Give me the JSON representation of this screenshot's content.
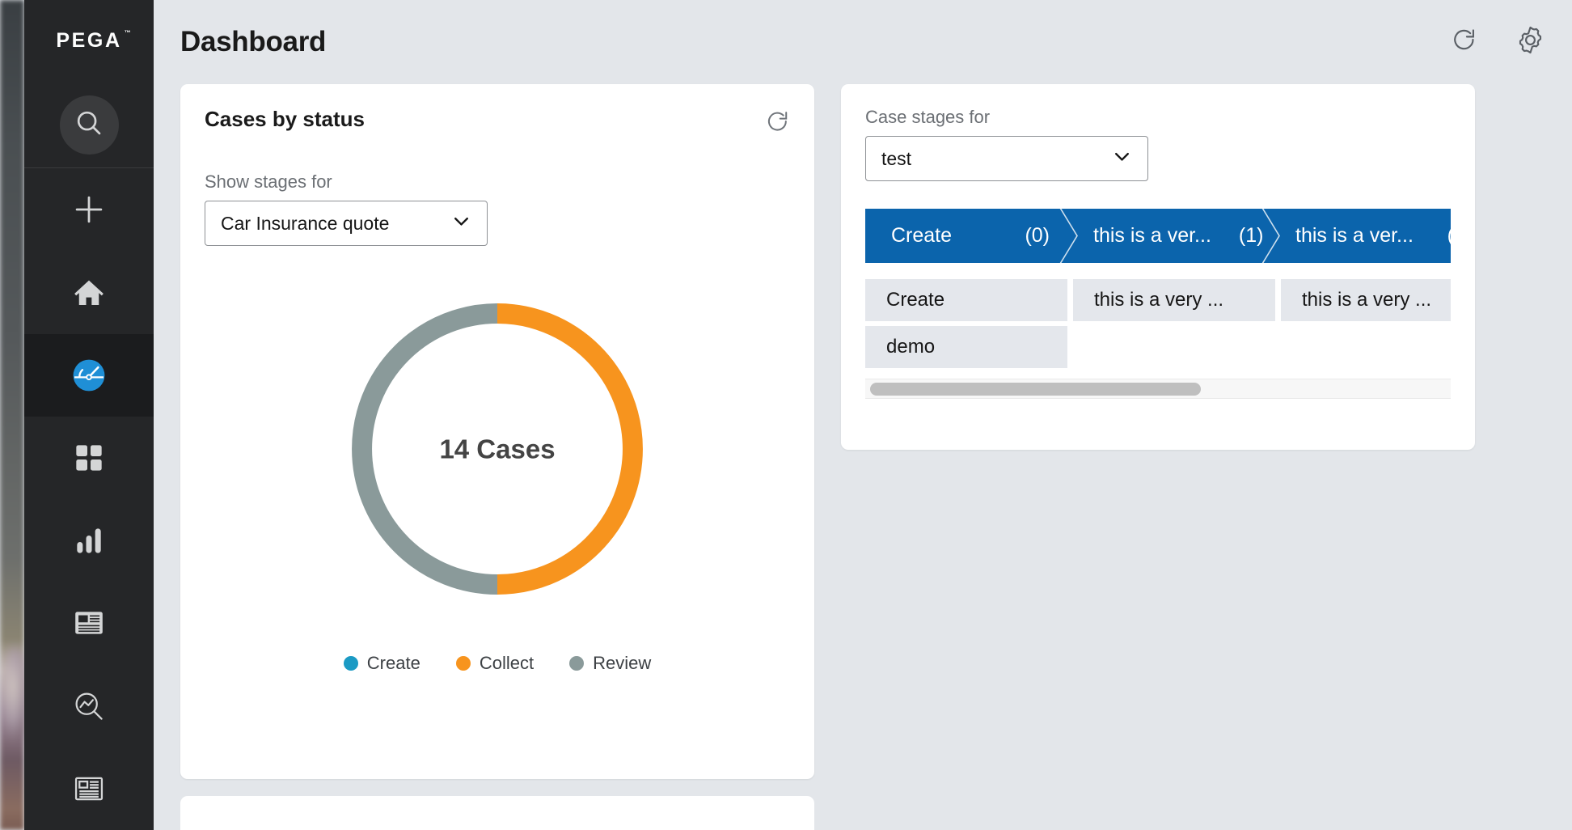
{
  "app": {
    "brand": "PEGA",
    "accent_blue": "#0b64ac",
    "sidebar_bg": "#252628"
  },
  "sidebar": {
    "search_icon_name": "search-icon",
    "items": [
      {
        "label": "Create",
        "icon": "plus-icon",
        "selected": false
      },
      {
        "label": "Home",
        "icon": "home-icon",
        "selected": false
      },
      {
        "label": "Dashboard",
        "icon": "dashboard-gauge-icon",
        "selected": true
      },
      {
        "label": "Apps",
        "icon": "grid-apps-icon",
        "selected": false
      },
      {
        "label": "Reports",
        "icon": "bar-chart-icon",
        "selected": false
      },
      {
        "label": "News",
        "icon": "article-icon",
        "selected": false
      },
      {
        "label": "Explore data",
        "icon": "chart-search-icon",
        "selected": false
      },
      {
        "label": "Documents",
        "icon": "document-outline-icon",
        "selected": false
      }
    ]
  },
  "header": {
    "title": "Dashboard",
    "actions": [
      {
        "name": "refresh-icon",
        "label": "Refresh"
      },
      {
        "name": "gear-icon",
        "label": "Settings"
      }
    ]
  },
  "cases_card": {
    "title": "Cases by status",
    "refresh_icon": "refresh-icon",
    "filter_label": "Show stages for",
    "filter_value": "Car Insurance quote",
    "chevron_icon": "chevron-down-icon",
    "center_label": "14 Cases"
  },
  "chart_data": {
    "type": "pie",
    "title": "Cases by status",
    "subtitle": "Show stages for Car Insurance quote",
    "center_text": "14 Cases",
    "total": 14,
    "unit": "Cases",
    "donut": true,
    "inner_radius_ratio": 0.86,
    "start_angle_deg": 0,
    "categories": [
      "Create",
      "Collect",
      "Review"
    ],
    "values": [
      0,
      7,
      7
    ],
    "percentages": [
      0,
      50,
      50
    ],
    "colors": [
      "#1b9ac4",
      "#f7941e",
      "#8a9a9a"
    ],
    "legend": [
      {
        "label": "Create",
        "color": "#1b9ac4",
        "value": 0
      },
      {
        "label": "Collect",
        "color": "#f7941e",
        "value": 7
      },
      {
        "label": "Review",
        "color": "#8a9a9a",
        "value": 7
      }
    ],
    "legend_position": "bottom",
    "grid": false,
    "xlabel": "",
    "ylabel": ""
  },
  "stages_card": {
    "filter_label": "Case stages for",
    "filter_value": "test",
    "chevron_icon": "chevron-down-icon",
    "stage_bar": [
      {
        "name": "Create",
        "count": "(0)"
      },
      {
        "name": "this is a ver...",
        "count": "(1)"
      },
      {
        "name": "this is a ver...",
        "count": "("
      }
    ],
    "chip_rows": [
      [
        "Create",
        "this is a very ...",
        "this is a very ..."
      ],
      [
        "demo"
      ]
    ],
    "scrollbar": {
      "name": "horizontal-scrollbar",
      "thumb_position_pct": 0,
      "thumb_width_pct": 42
    }
  }
}
